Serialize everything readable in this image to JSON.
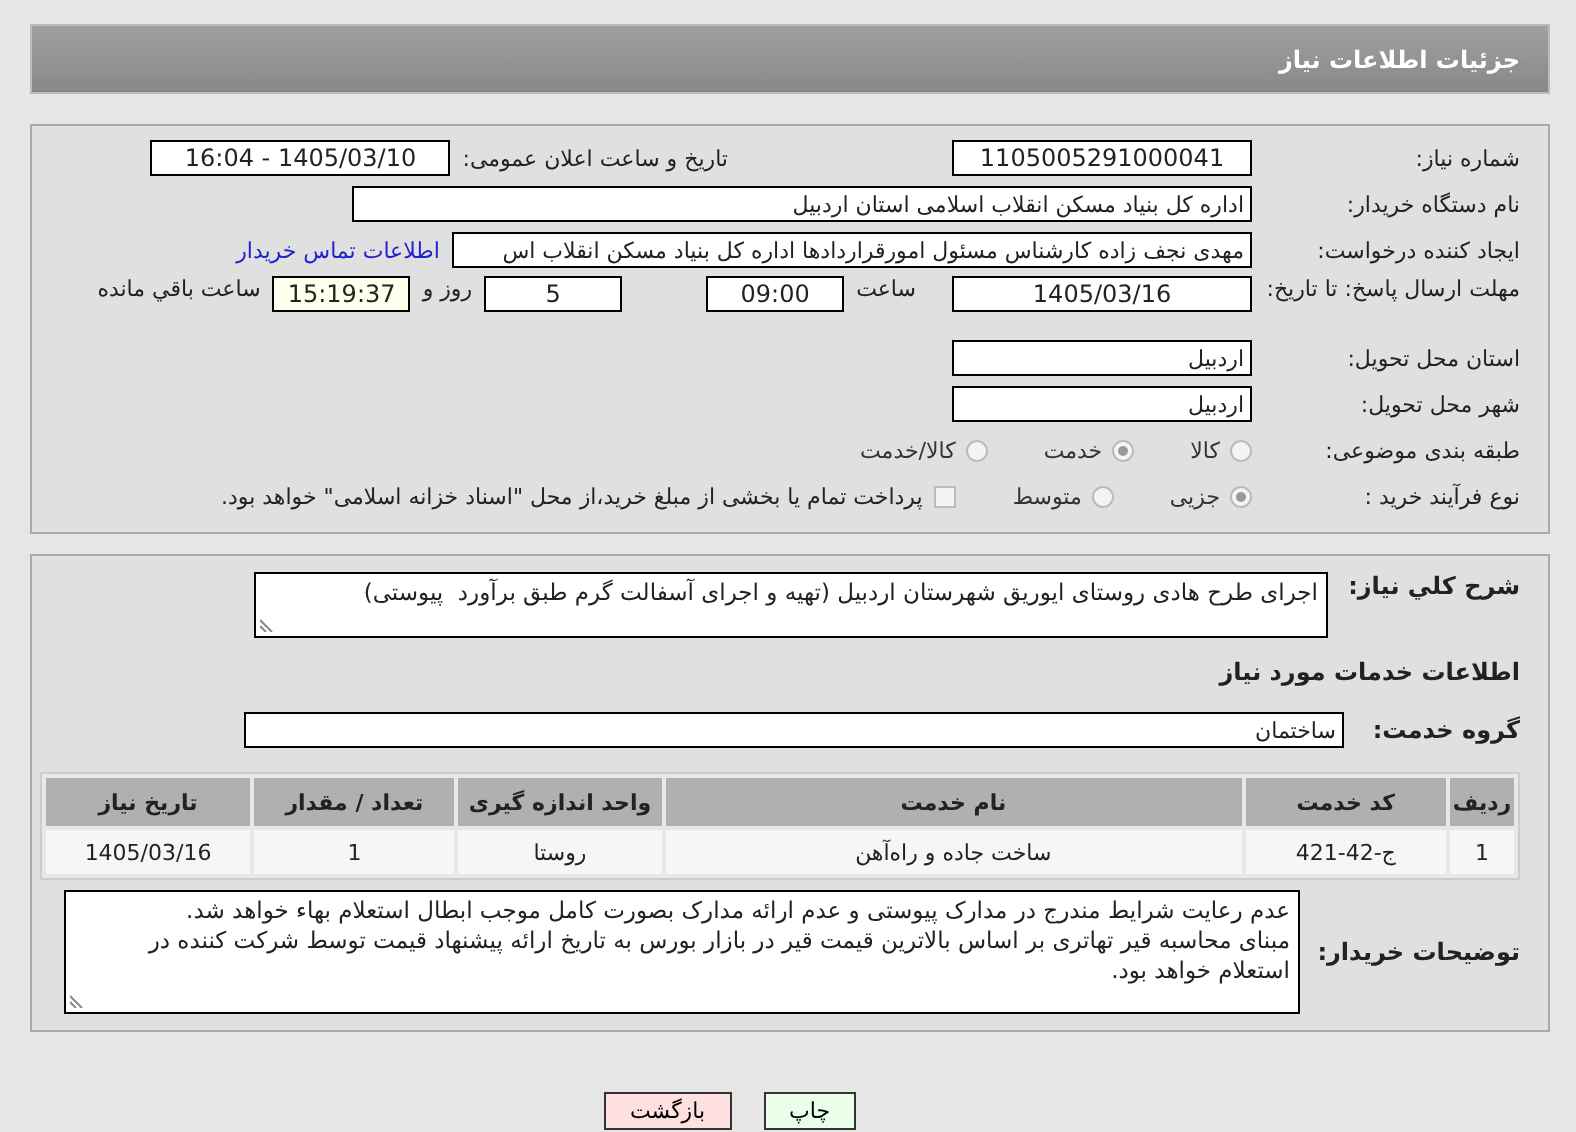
{
  "header": {
    "title": "جزئیات اطلاعات نیاز"
  },
  "need_number": {
    "label": "شماره نیاز:",
    "value": "1105005291000041"
  },
  "announce": {
    "label": "تاریخ و ساعت اعلان عمومی:",
    "value": "1405/03/10 - 16:04"
  },
  "buyer_org": {
    "label": "نام دستگاه خریدار:",
    "value": "اداره کل بنیاد مسکن انقلاب اسلامی استان اردبیل"
  },
  "requester": {
    "label": "ایجاد کننده درخواست:",
    "value": "مهدی نجف زاده کارشناس مسئول امورقراردادها اداره کل بنیاد مسکن انقلاب اس",
    "link": "اطلاعات تماس خریدار"
  },
  "deadline": {
    "label": "مهلت ارسال پاسخ: تا تاریخ:",
    "date": "1405/03/16",
    "time_label": "ساعت",
    "time": "09:00",
    "days": "5",
    "days_label": "روز و",
    "remaining": "15:19:37",
    "remaining_label": "ساعت باقي مانده"
  },
  "province": {
    "label": "استان محل تحویل:",
    "value": "اردبیل"
  },
  "city": {
    "label": "شهر محل تحویل:",
    "value": "اردبیل"
  },
  "category": {
    "label": "طبقه بندی موضوعی:",
    "options": [
      {
        "label": "کالا",
        "selected": false
      },
      {
        "label": "خدمت",
        "selected": true
      },
      {
        "label": "کالا/خدمت",
        "selected": false
      }
    ]
  },
  "purchase_type": {
    "label": "نوع فرآیند خرید :",
    "options": [
      {
        "label": "جزیی",
        "selected": true
      },
      {
        "label": "متوسط",
        "selected": false
      }
    ],
    "treasury": {
      "label": "پرداخت تمام یا بخشی از مبلغ خرید،از محل \"اسناد خزانه اسلامی\" خواهد بود.",
      "checked": false
    }
  },
  "description": {
    "label": "شرح کلي نیاز:",
    "value": "اجرای طرح هادی روستای ایوریق شهرستان اردبیل (تهیه و اجرای آسفالت گرم طبق برآورد  پیوستی)"
  },
  "services_heading": "اطلاعات خدمات مورد نیاز",
  "service_group": {
    "label": "گروه خدمت:",
    "value": "ساختمان"
  },
  "table": {
    "columns": [
      "ردیف",
      "کد خدمت",
      "نام خدمت",
      "واحد اندازه گیری",
      "تعداد / مقدار",
      "تاریخ نیاز"
    ],
    "rows": [
      [
        "1",
        "ج-42-421",
        "ساخت جاده و راه‌آهن",
        "روستا",
        "1",
        "1405/03/16"
      ]
    ]
  },
  "buyer_notes": {
    "label": "توضیحات خریدار:",
    "value": "عدم رعایت شرایط مندرج در مدارک پیوستی و عدم ارائه مدارک بصورت کامل موجب ابطال استعلام بهاء خواهد شد.\nمبنای محاسبه قیر تهاتری بر اساس بالاترین قیمت قیر در بازار بورس به تاریخ ارائه پیشنهاد قیمت توسط شرکت کننده در استعلام خواهد بود."
  },
  "buttons": [
    {
      "label": "چاپ",
      "kind": "print"
    },
    {
      "label": "بازگشت",
      "kind": "back"
    }
  ]
}
